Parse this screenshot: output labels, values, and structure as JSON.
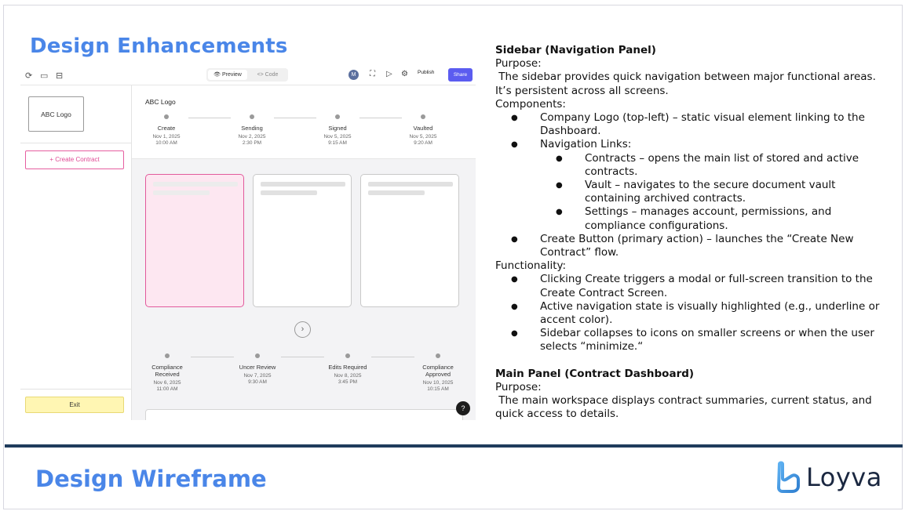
{
  "header": {
    "title": "Design Enhancements"
  },
  "footer": {
    "title": "Design Wireframe",
    "brand": "Loyva"
  },
  "colors": {
    "accent": "#4a86e8",
    "divider": "#1f3b5c",
    "pink": "#e25a9c",
    "share": "#5b5cf0"
  },
  "wireframe": {
    "toolbar": {
      "left_icons": [
        "refresh-icon",
        "panel-icon",
        "layout-icon"
      ],
      "preview_label": "Preview",
      "code_label": "<> Code",
      "avatar": "M",
      "right_icons": [
        "scan-icon",
        "play-icon",
        "settings-icon"
      ],
      "publish_label": "Publish",
      "share_label": "Share"
    },
    "sidebar": {
      "logo": "ABC Logo",
      "create_label": "+  Create Contract",
      "exit_label": "Exit"
    },
    "main": {
      "title": "ABC Logo",
      "top_steps": [
        {
          "label": "Create",
          "date": "Nov 1, 2025",
          "time": "10:00 AM"
        },
        {
          "label": "Sending",
          "date": "Nov 2, 2025",
          "time": "2:30 PM"
        },
        {
          "label": "Signed",
          "date": "Nov 5, 2025",
          "time": "9:15 AM"
        },
        {
          "label": "Vaulted",
          "date": "Nov 5, 2025",
          "time": "9:20 AM"
        }
      ],
      "bottom_steps": [
        {
          "label": "Compliance Received",
          "date": "Nov 6, 2025",
          "time": "11:00 AM"
        },
        {
          "label": "Uncer Review",
          "date": "Nov 7, 2025",
          "time": "9:30 AM"
        },
        {
          "label": "Edits Required",
          "date": "Nov 8, 2025",
          "time": "3:45 PM"
        },
        {
          "label": "Compliance Approved",
          "date": "Nov 10, 2025",
          "time": "10:15 AM"
        }
      ],
      "help": "?"
    }
  },
  "doc": {
    "sidebar_heading": "Sidebar (Navigation Panel)",
    "purpose_label": "Purpose:",
    "purpose_text": " The sidebar provides quick navigation between major functional areas. It’s persistent across all screens.",
    "components_label": "Components:",
    "company_logo": "Company Logo (top-left) – static visual element linking to the Dashboard.",
    "nav_links": "Navigation Links:",
    "contracts": "Contracts – opens the main list of stored and active contracts.",
    "vault": "Vault – navigates to the secure document vault containing archived contracts.",
    "settings": "Settings – manages account, permissions, and compliance configurations.",
    "create_button": "Create Button (primary action) – launches the “Create New Contract” flow.",
    "functionality_label": "Functionality:",
    "f1": "Clicking Create triggers a modal or full-screen transition to the Create Contract Screen.",
    "f2": "Active navigation state is visually highlighted (e.g., underline or accent color).",
    "f3": "Sidebar collapses to icons on smaller screens or when the user selects “minimize.“",
    "main_heading": "Main Panel (Contract Dashboard)",
    "main_purpose_label": "Purpose:",
    "main_purpose_text": " The main workspace displays contract summaries, current status, and quick access to details."
  }
}
